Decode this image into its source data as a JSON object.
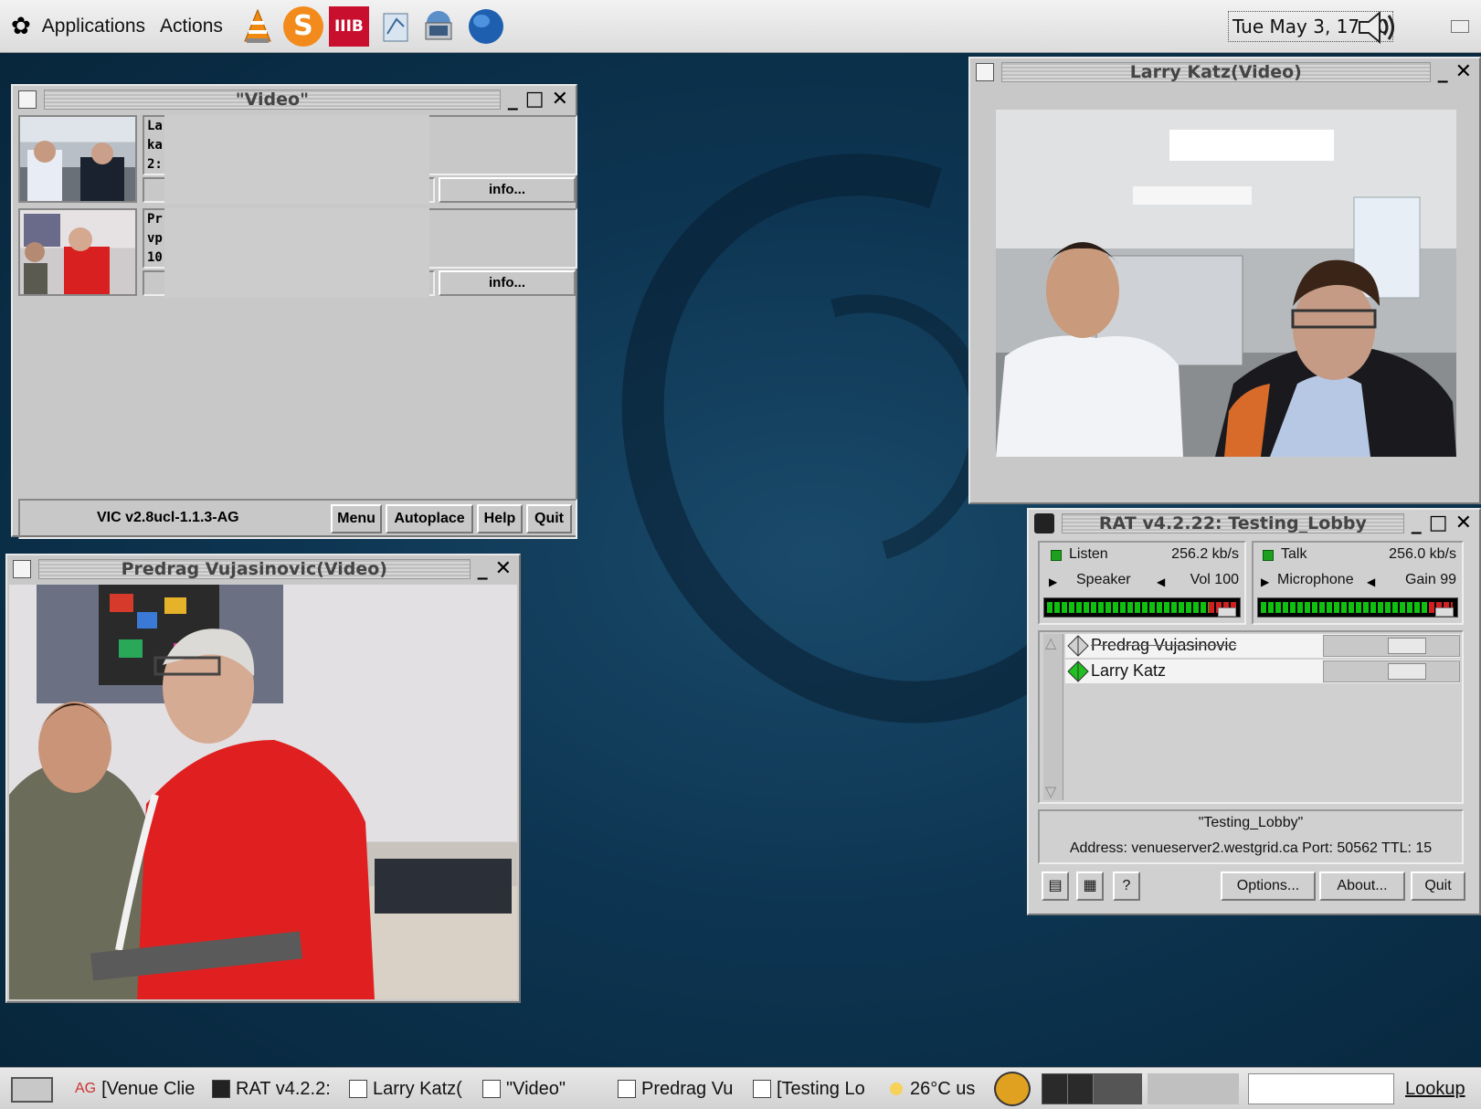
{
  "top_panel": {
    "applications": "Applications",
    "actions": "Actions",
    "clock": "Tue May  3, 17:40",
    "launchers": [
      "vlc-icon",
      "skype-icon",
      "iiib-icon",
      "files-icon",
      "network-icon",
      "globe-icon"
    ],
    "ub_badge": "IIIB"
  },
  "vic": {
    "title": "\"Video\"",
    "rows": [
      {
        "line1": "La",
        "line2": "ka",
        "line3": " 2:",
        "info": "info..."
      },
      {
        "line1": "Pr",
        "line2": "vp",
        "line3": "10",
        "info": "info..."
      }
    ],
    "version": "VIC v2.8ucl-1.1.3-AG",
    "buttons": {
      "menu": "Menu",
      "autoplace": "Autoplace",
      "help": "Help",
      "quit": "Quit"
    }
  },
  "larry_window": {
    "title": "Larry Katz(Video)"
  },
  "predrag_window": {
    "title": "Predrag Vujasinovic(Video)"
  },
  "rat": {
    "title": "RAT v4.2.22: Testing_Lobby",
    "listen": {
      "label": "Listen",
      "rate": "256.2 kb/s",
      "device": "Speaker",
      "vol_label": "Vol 100"
    },
    "talk": {
      "label": "Talk",
      "rate": "256.0 kb/s",
      "device": "Microphone",
      "gain_label": "Gain  99"
    },
    "participants": [
      "Predrag Vujasinovic",
      "Larry Katz"
    ],
    "session": "\"Testing_Lobby\"",
    "address": "Address: venueserver2.westgrid.ca Port: 50562 TTL: 15",
    "buttons": {
      "options": "Options...",
      "about": "About...",
      "quit": "Quit"
    }
  },
  "taskbar": {
    "tasks": [
      "[Venue Clie",
      "RAT v4.2.2:",
      "Larry Katz(",
      "\"Video\"",
      "Predrag Vu",
      "[Testing Lo"
    ],
    "ag_label": "AG",
    "weather": "26°C  us",
    "lookup": "Lookup"
  },
  "colors": {
    "desktop": "#0d3552",
    "panel": "#dcdcdc",
    "window": "#c8c8c8",
    "led": "#1ea01e"
  }
}
